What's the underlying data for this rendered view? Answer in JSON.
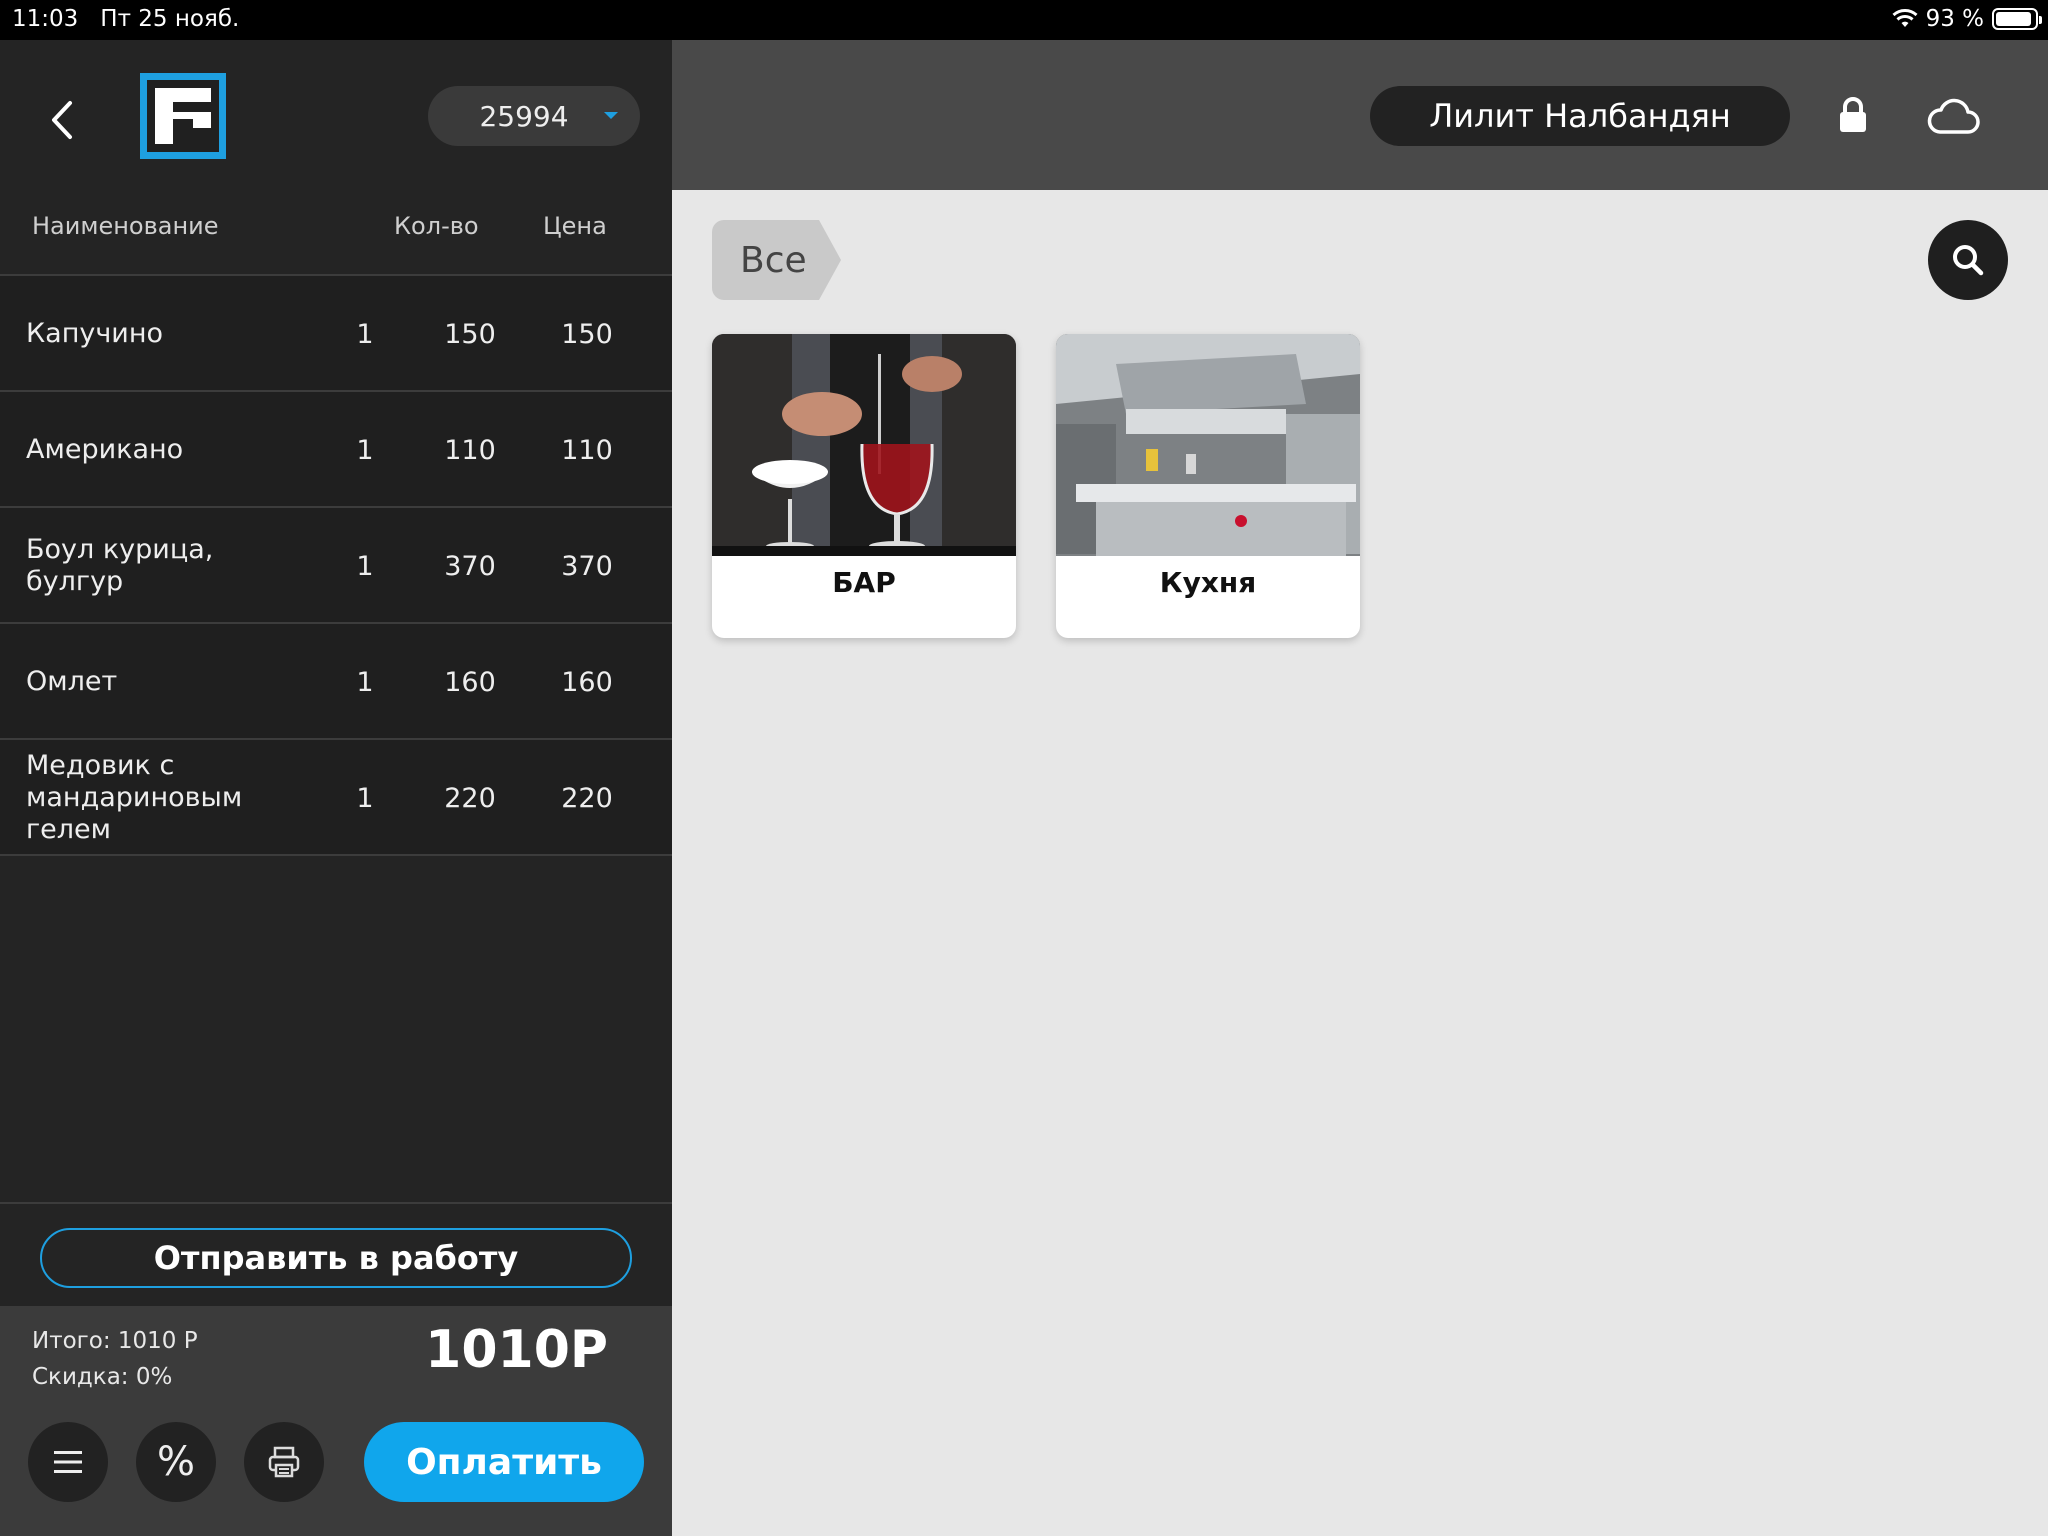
{
  "status_bar": {
    "time": "11:03",
    "date": "Пт 25 нояб.",
    "battery": "93 %"
  },
  "left_panel": {
    "order_number": "25994",
    "columns": {
      "name": "Наименование",
      "qty": "Кол-во",
      "price": "Цена"
    },
    "items": [
      {
        "name": "Капучино",
        "qty": "1",
        "price": "150",
        "sum": "150"
      },
      {
        "name": "Американо",
        "qty": "1",
        "price": "110",
        "sum": "110"
      },
      {
        "name": "Боул курица, булгур",
        "qty": "1",
        "price": "370",
        "sum": "370"
      },
      {
        "name": "Омлет",
        "qty": "1",
        "price": "160",
        "sum": "160"
      },
      {
        "name": "Медовик с мандариновым гелем",
        "qty": "1",
        "price": "220",
        "sum": "220"
      }
    ],
    "send_button": "Отправить в работу",
    "subtotal": "Итого: 1010 Р",
    "discount": "Скидка: 0%",
    "grand_total": "1010Р",
    "percent_label": "%",
    "pay_button": "Оплатить"
  },
  "top_bar": {
    "user_name": "Лилит Налбандян"
  },
  "catalog": {
    "breadcrumb": "Все",
    "categories": [
      {
        "title": "БАР"
      },
      {
        "title": "Кухня"
      }
    ]
  },
  "colors": {
    "accent": "#1e9fe0",
    "pay": "#10a6ec",
    "panel_dark": "#242424",
    "topbar": "#494949",
    "content_bg": "#e7e7e7"
  }
}
